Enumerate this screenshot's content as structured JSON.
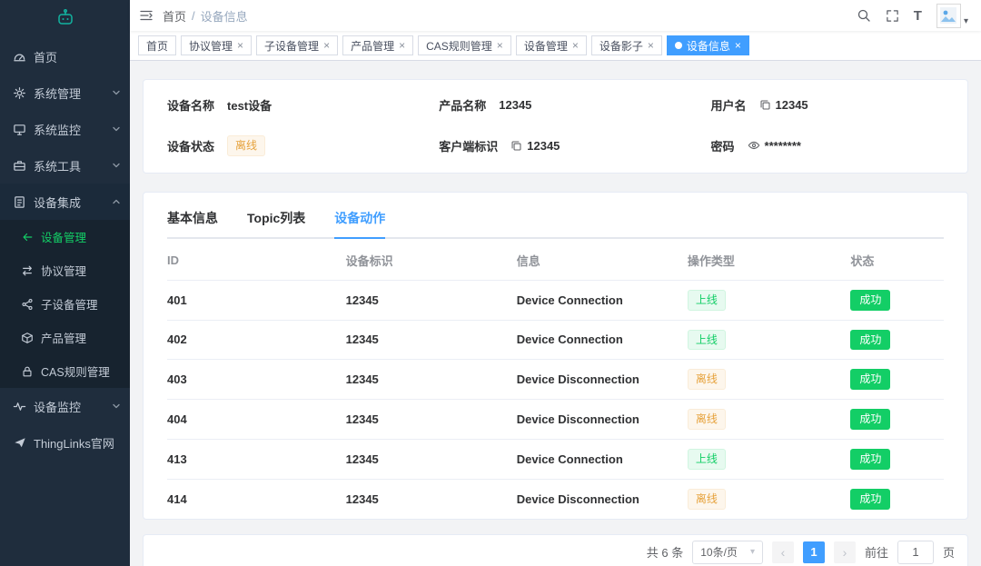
{
  "icons": {
    "close": "×",
    "caret_down": "▾",
    "chevron_left": "‹",
    "chevron_right": "›",
    "font_size_letter": "T"
  },
  "colors": {
    "accent_blue": "#409eff",
    "accent_green": "#13ce66",
    "warning_orange": "#e6a23c",
    "sidebar_bg": "#1f2d3d"
  },
  "sidebar": {
    "items": [
      {
        "label": "首页"
      },
      {
        "label": "系统管理"
      },
      {
        "label": "系统监控"
      },
      {
        "label": "系统工具"
      },
      {
        "label": "设备集成",
        "expanded": true,
        "children": [
          {
            "label": "设备管理",
            "active": true
          },
          {
            "label": "协议管理"
          },
          {
            "label": "子设备管理"
          },
          {
            "label": "产品管理"
          },
          {
            "label": "CAS规则管理"
          }
        ]
      },
      {
        "label": "设备监控"
      },
      {
        "label": "ThingLinks官网"
      }
    ]
  },
  "topbar": {
    "breadcrumb": {
      "root": "首页",
      "separator": "/",
      "current": "设备信息"
    }
  },
  "tags": [
    {
      "label": "首页"
    },
    {
      "label": "协议管理"
    },
    {
      "label": "子设备管理"
    },
    {
      "label": "产品管理"
    },
    {
      "label": "CAS规则管理"
    },
    {
      "label": "设备管理"
    },
    {
      "label": "设备影子"
    },
    {
      "label": "设备信息",
      "active": true
    }
  ],
  "device_info": {
    "name_label": "设备名称",
    "name_value": "test设备",
    "status_label": "设备状态",
    "status_value": "离线",
    "product_label": "产品名称",
    "product_value": "12345",
    "client_label": "客户端标识",
    "client_value": "12345",
    "user_label": "用户名",
    "user_value": "12345",
    "password_label": "密码",
    "password_value": "********"
  },
  "detail_tabs": [
    {
      "label": "基本信息"
    },
    {
      "label": "Topic列表"
    },
    {
      "label": "设备动作",
      "active": true
    }
  ],
  "table": {
    "columns": [
      "ID",
      "设备标识",
      "信息",
      "操作类型",
      "状态"
    ],
    "rows": [
      {
        "id": "401",
        "device_id": "12345",
        "message": "Device Connection",
        "op_type": "上线",
        "status": "成功"
      },
      {
        "id": "402",
        "device_id": "12345",
        "message": "Device Connection",
        "op_type": "上线",
        "status": "成功"
      },
      {
        "id": "403",
        "device_id": "12345",
        "message": "Device Disconnection",
        "op_type": "离线",
        "status": "成功"
      },
      {
        "id": "404",
        "device_id": "12345",
        "message": "Device Disconnection",
        "op_type": "离线",
        "status": "成功"
      },
      {
        "id": "413",
        "device_id": "12345",
        "message": "Device Connection",
        "op_type": "上线",
        "status": "成功"
      },
      {
        "id": "414",
        "device_id": "12345",
        "message": "Device Disconnection",
        "op_type": "离线",
        "status": "成功"
      }
    ]
  },
  "pagination": {
    "total": "共 6 条",
    "page_size": "10条/页",
    "page": "1",
    "goto_label": "前往",
    "goto_value": "1",
    "goto_suffix": "页"
  }
}
